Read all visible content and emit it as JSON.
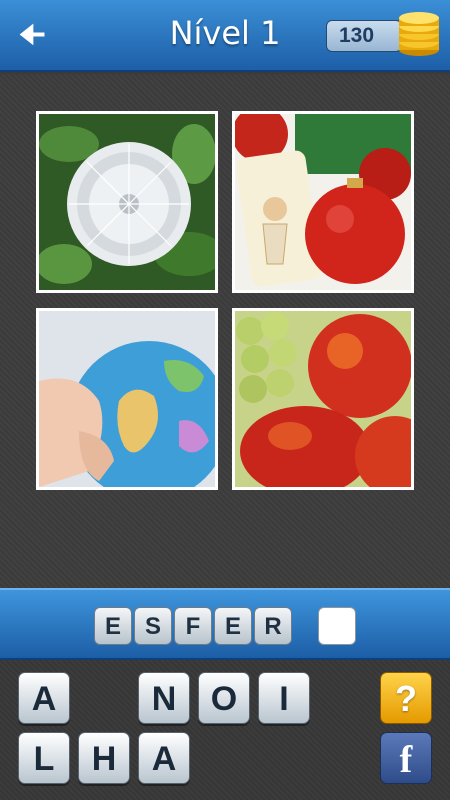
{
  "header": {
    "title": "Nível 1",
    "coins": "130",
    "back_icon": "arrow-left-icon",
    "coins_icon": "coin-stack-icon"
  },
  "pictures": [
    {
      "subject": "dandelion"
    },
    {
      "subject": "christmas-candle-and-bauble"
    },
    {
      "subject": "globe-in-hand"
    },
    {
      "subject": "grapes-and-nectarines"
    }
  ],
  "answer": {
    "letters": [
      "E",
      "S",
      "F",
      "E",
      "R",
      ""
    ]
  },
  "pool": {
    "row1": [
      "A",
      "",
      "N",
      "O",
      "I"
    ],
    "row2": [
      "L",
      "H",
      "A",
      "",
      ""
    ]
  },
  "buttons": {
    "hint_label": "?",
    "facebook_label": "f"
  },
  "colors": {
    "header": "#2a78c4",
    "hint": "#f2b51f",
    "facebook": "#3b5998"
  }
}
